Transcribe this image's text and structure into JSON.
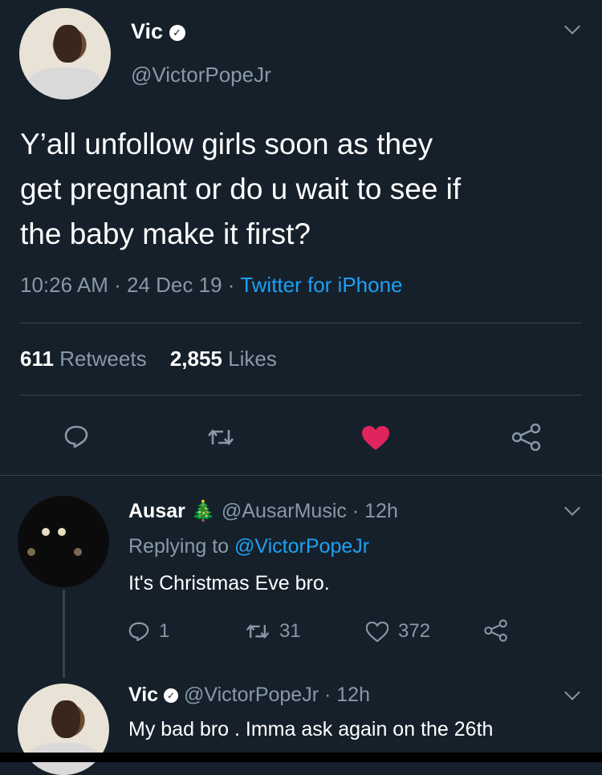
{
  "tweet": {
    "author_name": "Vic",
    "handle": "@VictorPopeJr",
    "text_line1": "Y’all unfollow girls soon as they",
    "text_line2": "get pregnant or do u wait to see if",
    "text_line3": "the baby make it first?",
    "time": "10:26 AM",
    "date": "24 Dec 19",
    "source": "Twitter for iPhone",
    "retweet_count": "611",
    "retweet_label": "Retweets",
    "like_count": "2,855",
    "like_label": "Likes"
  },
  "reply1": {
    "author_name": "Ausar",
    "handle": "@AusarMusic",
    "time": "12h",
    "replying_prefix": "Replying to",
    "replying_to": "@VictorPopeJr",
    "text": "It's Christmas Eve bro.",
    "reply_count": "1",
    "retweet_count": "31",
    "like_count": "372"
  },
  "reply2": {
    "author_name": "Vic",
    "handle": "@VictorPopeJr",
    "time": "12h",
    "text": "My bad bro . Imma ask again on the 26th"
  },
  "icons": {
    "verified": "verified-badge-icon",
    "chevron": "chevron-down-icon",
    "reply": "reply-icon",
    "retweet": "retweet-icon",
    "like": "heart-icon",
    "share": "share-icon",
    "tree": "christmas-tree-icon"
  },
  "colors": {
    "background": "#15202b",
    "liked_heart": "#e0245e",
    "link": "#1da1f2",
    "muted": "#8899a6"
  }
}
